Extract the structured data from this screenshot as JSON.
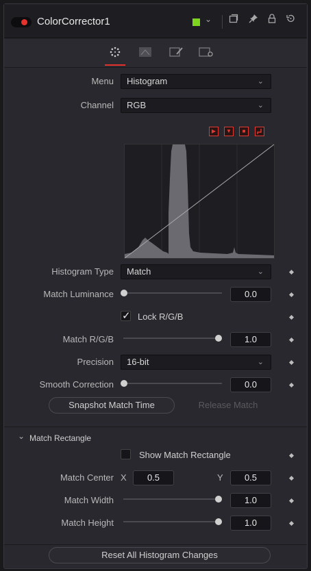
{
  "header": {
    "node_name": "ColorCorrector1",
    "color_swatch": "#7ed41e",
    "icons": [
      "window-icon",
      "pin-icon",
      "lock-icon",
      "reset-icon"
    ]
  },
  "tabs": [
    "color-tab-icon",
    "levels-tab-icon",
    "options-tab-icon",
    "settings-tab-icon"
  ],
  "controls": {
    "menu_label": "Menu",
    "menu_value": "Histogram",
    "channel_label": "Channel",
    "channel_value": "RGB",
    "histogram_type_label": "Histogram Type",
    "histogram_type_value": "Match",
    "match_luminance_label": "Match Luminance",
    "match_luminance_value": "0.0",
    "match_luminance_level": 0.0,
    "lock_rgb_label": "Lock R/G/B",
    "lock_rgb_checked": true,
    "match_rgb_label": "Match R/G/B",
    "match_rgb_value": "1.0",
    "match_rgb_level": 1.0,
    "precision_label": "Precision",
    "precision_value": "16-bit",
    "smooth_correction_label": "Smooth Correction",
    "smooth_correction_value": "0.0",
    "smooth_correction_level": 0.0,
    "snapshot_button": "Snapshot Match Time",
    "release_button": "Release Match"
  },
  "match_rectangle": {
    "section_title": "Match Rectangle",
    "show_label": "Show Match Rectangle",
    "show_checked": false,
    "center_label": "Match Center",
    "x_label": "X",
    "center_x": "0.5",
    "y_label": "Y",
    "center_y": "0.5",
    "width_label": "Match Width",
    "width_value": "1.0",
    "width_level": 1.0,
    "height_label": "Match Height",
    "height_value": "1.0",
    "height_level": 1.0
  },
  "reset_button": "Reset All Histogram Changes",
  "histogram_buttons": [
    "play-icon",
    "dropdown-icon",
    "stop-icon",
    "curve-icon"
  ]
}
